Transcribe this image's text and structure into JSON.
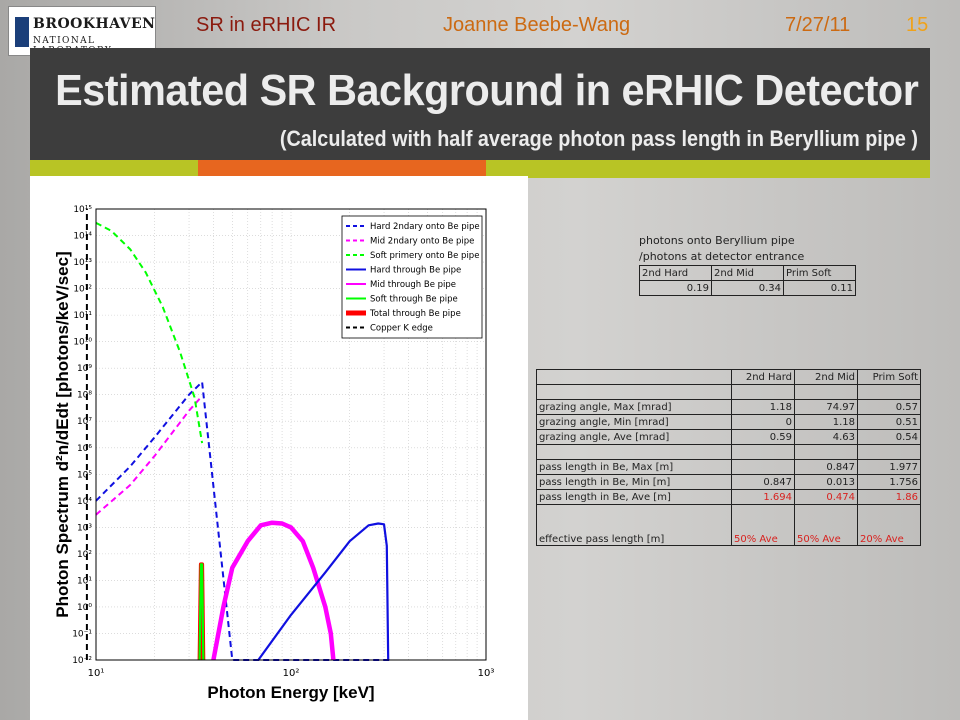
{
  "header": {
    "logo_line1": "BROOKHAVEN",
    "logo_line2": "NATIONAL LABORATORY",
    "topic": "SR in eRHIC IR",
    "author": "Joanne Beebe-Wang",
    "date": "7/27/11",
    "page": "15"
  },
  "title": "Estimated SR Background in eRHIC Detector",
  "subtitle": "(Calculated with half average photon pass length in Beryllium pipe )",
  "colors": {
    "title_bar": "#3d3d3d",
    "accent_green": "#b8c425",
    "accent_orange": "#e7661f",
    "header_red": "#8b1a0e",
    "header_orange": "#cc6a12",
    "page_number": "#f0a21a",
    "table_red": "#d8221f"
  },
  "chart_data": {
    "type": "line",
    "xscale": "log",
    "yscale": "log",
    "xlim": [
      10,
      1000
    ],
    "ylim": [
      0.01,
      1000000000000000.0
    ],
    "xlabel": "Photon Energy [keV]",
    "ylabel": "Photon Spectrum d²n/dEdt [photons/keV/sec]",
    "xticks": [
      "10¹",
      "10²",
      "10³"
    ],
    "yticks": [
      "10⁻²",
      "10⁻¹",
      "10⁰",
      "10¹",
      "10²",
      "10³",
      "10⁴",
      "10⁵",
      "10⁶",
      "10⁷",
      "10⁸",
      "10⁹",
      "10¹⁰",
      "10¹¹",
      "10¹²",
      "10¹³",
      "10¹⁴",
      "10¹⁵"
    ],
    "grid": true,
    "legend_position": "top-right",
    "series": [
      {
        "name": "Hard 2ndary onto Be pipe",
        "color": "#1010e0",
        "dash": true,
        "x": [
          10,
          15,
          20,
          30,
          35,
          50,
          70,
          100,
          150,
          200,
          250,
          300,
          320,
          330,
          333
        ],
        "y": [
          10000.0,
          200000.0,
          2500000.0,
          100000000.0,
          300000000.0,
          1e-09,
          1e-09,
          1e-09,
          1e-09,
          1e-09,
          1e-09,
          1e-09,
          1e-09,
          1e-09,
          1e-09
        ]
      },
      {
        "name": "Mid 2ndary onto Be pipe",
        "color": "#ff00ff",
        "dash": true,
        "x": [
          10,
          15,
          20,
          30,
          34
        ],
        "y": [
          3000.0,
          40000.0,
          500000.0,
          25000000.0,
          70000000.0
        ]
      },
      {
        "name": "Soft primery onto Be pipe",
        "color": "#00ff00",
        "dash": true,
        "x": [
          10,
          12,
          15,
          18,
          22,
          27,
          32,
          35
        ],
        "y": [
          300000000000000.0,
          150000000000000.0,
          30000000000000.0,
          4000000000000.0,
          200000000000.0,
          4000000000.0,
          80000000.0,
          1500000.0
        ]
      },
      {
        "name": "Hard through Be pipe",
        "color": "#1010e0",
        "dash": false,
        "x": [
          68,
          100,
          150,
          200,
          250,
          280,
          300,
          310,
          315
        ],
        "y": [
          0.01,
          0.5,
          20,
          300,
          1200,
          1400,
          1300,
          200,
          0.01
        ]
      },
      {
        "name": "Mid through Be pipe",
        "color": "#ff00ff",
        "dash": false,
        "x": [
          40,
          45,
          50,
          60,
          70,
          80,
          90,
          100,
          115,
          130,
          150,
          160,
          165
        ],
        "y": [
          0.01,
          1,
          30,
          300,
          1200,
          1500,
          1400,
          1000,
          300,
          30,
          1,
          0.1,
          0.01
        ]
      },
      {
        "name": "Soft through Be pipe",
        "color": "#00ff00",
        "dash": false,
        "x": [
          34,
          34.5,
          35,
          35.5
        ],
        "y": [
          0.01,
          40,
          40,
          0.01
        ]
      },
      {
        "name": "Total through Be pipe",
        "color": "#ff0000",
        "dash": false,
        "x": [
          34,
          34.5,
          35,
          35.5
        ],
        "y": [
          0.01,
          40,
          40,
          0.01
        ]
      },
      {
        "name": "Copper K edge",
        "color": "#000000",
        "dash": true,
        "x": [
          8.98,
          8.98
        ],
        "y": [
          0.01,
          1000000000000000.0
        ]
      }
    ]
  },
  "table1": {
    "caption_line1": "photons  onto Beryllium pipe",
    "caption_line2": "/photons  at detector entrance",
    "headers": [
      "2nd Hard",
      "2nd Mid",
      "Prim Soft"
    ],
    "values": [
      "0.19",
      "0.34",
      "0.11"
    ]
  },
  "table2": {
    "headers": [
      "",
      "2nd Hard",
      "2nd Mid",
      "Prim Soft"
    ],
    "rows": [
      [
        "grazing angle, Max [mrad]",
        "1.18",
        "74.97",
        "0.57"
      ],
      [
        "grazing angle, Min [mrad]",
        "0",
        "1.18",
        "0.51"
      ],
      [
        "grazing angle, Ave [mrad]",
        "0.59",
        "4.63",
        "0.54"
      ],
      [
        "pass length in Be, Max [m]",
        "",
        "0.847",
        "1.977"
      ],
      [
        "pass length in Be, Min [m]",
        "0.847",
        "0.013",
        "1.756"
      ],
      [
        "pass length in Be, Ave [m]",
        "1.694",
        "0.474",
        "1.86"
      ],
      [
        "effective pass length  [m]",
        "50% Ave",
        "50% Ave",
        "20% Ave"
      ]
    ]
  }
}
